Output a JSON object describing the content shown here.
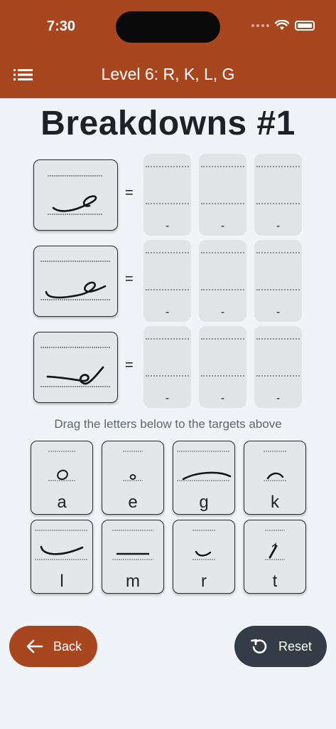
{
  "status_bar": {
    "time": "7:30"
  },
  "app_bar": {
    "title": "Level 6: R, K, L, G",
    "menu_icon": "menu-icon"
  },
  "page": {
    "title": "Breakdowns #1"
  },
  "rows": [
    {
      "equals": "=",
      "targets": [
        "-",
        "-",
        "-"
      ]
    },
    {
      "equals": "=",
      "targets": [
        "-",
        "-",
        "-"
      ]
    },
    {
      "equals": "=",
      "targets": [
        "-",
        "-",
        "-"
      ]
    }
  ],
  "instruction": "Drag the letters below to the targets above",
  "letters": [
    "a",
    "e",
    "g",
    "k",
    "l",
    "m",
    "r",
    "t"
  ],
  "buttons": {
    "back": "Back",
    "reset": "Reset"
  },
  "colors": {
    "accent": "#a8461f",
    "reset": "#343d47",
    "background": "#f0f3f7"
  }
}
